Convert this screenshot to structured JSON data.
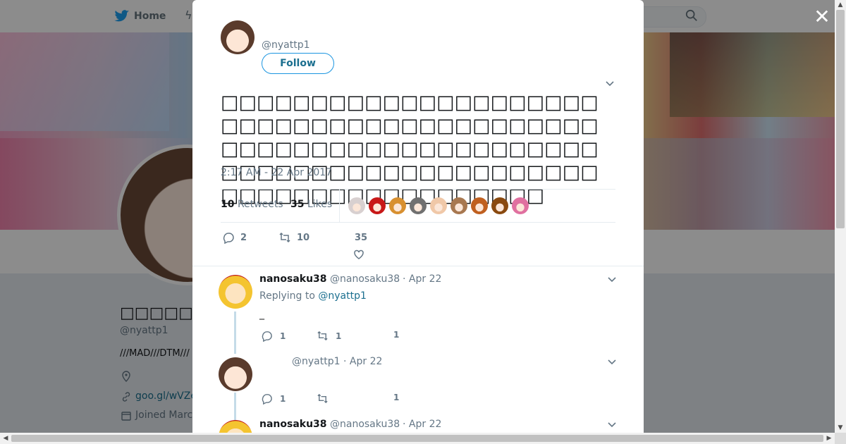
{
  "topbar": {
    "home_label": "Home"
  },
  "profile": {
    "name": "□□□□□",
    "handle": "@nyattp1",
    "bio": "///MAD///DTM///",
    "link": "goo.gl/wVZe",
    "joined": "Joined March"
  },
  "modal": {
    "author_handle": "@nyattp1",
    "follow_label": "Follow",
    "tweet_text": "□□□□□□□□□□□□□□□□□□□□□□□□□□□□□□□□□□□□□□□□□□□□□□□□□□□□□□□□□□□□□□□□□□□□□□□□□□□□□□□□□□□□□□□□□□□□□□□□□□□□□□",
    "timestamp": "2:17 AM - 22 Apr 2017",
    "stats": {
      "retweets_count": "10",
      "retweets_label": "Retweets",
      "likes_count": "35",
      "likes_label": "Likes"
    },
    "liker_colors": [
      "#d8d0d0",
      "#c81818",
      "#d89030",
      "#707070",
      "#f0c8a8",
      "#a87850",
      "#c06020",
      "#8a4a10",
      "#e070a0"
    ],
    "actions": {
      "replies": "2",
      "retweets": "10",
      "likes": "35"
    }
  },
  "replies": [
    {
      "name": "nanosaku38",
      "handle": "@nanosaku38",
      "date": "· Apr 22",
      "replying_prefix": "Replying to",
      "replying_to": "@nyattp1",
      "body": "_",
      "reply_count": "1",
      "retweet_count": "1",
      "like_count": "1"
    },
    {
      "name": "",
      "handle": "@nyattp1",
      "date": "· Apr 22",
      "reply_count": "1",
      "retweet_count": "",
      "like_count": "1"
    },
    {
      "name": "nanosaku38",
      "handle": "@nanosaku38",
      "date": "· Apr 22"
    }
  ]
}
